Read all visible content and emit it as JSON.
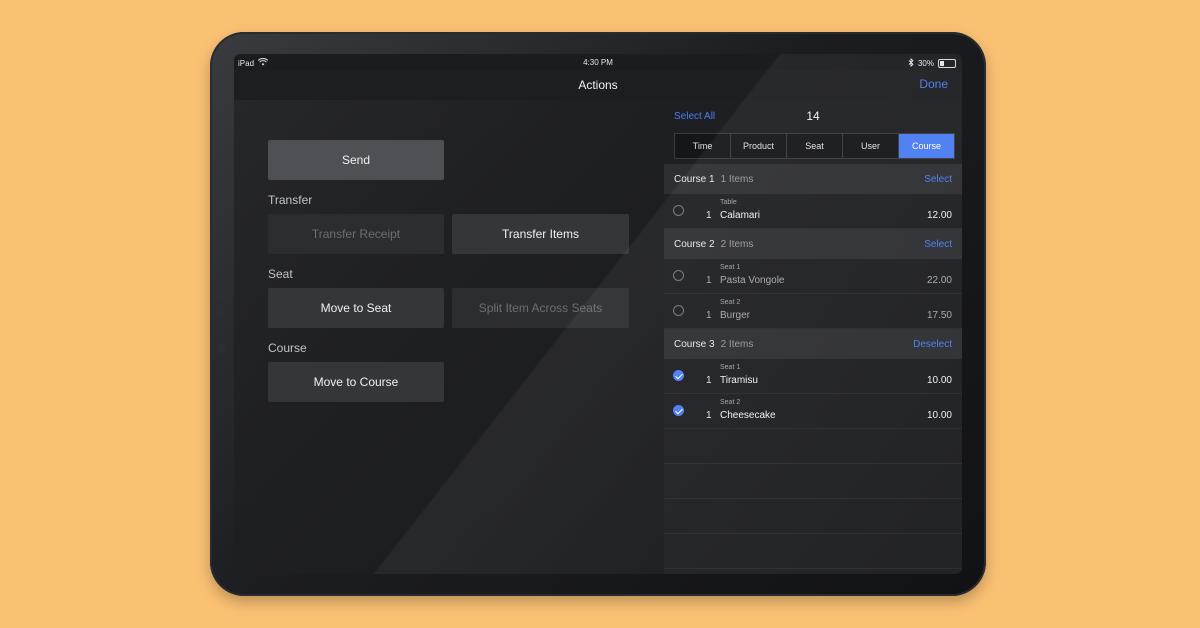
{
  "status_bar": {
    "carrier": "iPad",
    "time": "4:30 PM",
    "battery_text": "30%",
    "battery_level": 0.3,
    "icons": [
      "wifi-icon",
      "bluetooth-icon",
      "battery-icon"
    ]
  },
  "nav": {
    "title": "Actions",
    "done": "Done"
  },
  "left": {
    "send": "Send",
    "transfer_label": "Transfer",
    "transfer_receipt": "Transfer Receipt",
    "transfer_items": "Transfer Items",
    "seat_label": "Seat",
    "move_to_seat": "Move to Seat",
    "split_item": "Split Item Across Seats",
    "course_label": "Course",
    "move_to_course": "Move to Course"
  },
  "right": {
    "select_all": "Select All",
    "count": "14",
    "tabs": [
      {
        "label": "Time"
      },
      {
        "label": "Product"
      },
      {
        "label": "Seat"
      },
      {
        "label": "User"
      },
      {
        "label": "Course",
        "active": true
      }
    ],
    "courses": [
      {
        "name": "Course 1",
        "count": "1 Items",
        "action": "Select",
        "items": [
          {
            "seat": "Table",
            "qty": "1",
            "name": "Calamari",
            "price": "12.00",
            "checked": false,
            "muted": false
          }
        ]
      },
      {
        "name": "Course 2",
        "count": "2 Items",
        "action": "Select",
        "items": [
          {
            "seat": "Seat 1",
            "qty": "1",
            "name": "Pasta Vongole",
            "price": "22.00",
            "checked": false,
            "muted": true
          },
          {
            "seat": "Seat 2",
            "qty": "1",
            "name": "Burger",
            "price": "17.50",
            "checked": false,
            "muted": true
          }
        ]
      },
      {
        "name": "Course 3",
        "count": "2 Items",
        "action": "Deselect",
        "items": [
          {
            "seat": "Seat 1",
            "qty": "1",
            "name": "Tiramisu",
            "price": "10.00",
            "checked": true,
            "muted": false
          },
          {
            "seat": "Seat 2",
            "qty": "1",
            "name": "Cheesecake",
            "price": "10.00",
            "checked": true,
            "muted": false
          }
        ]
      }
    ],
    "accent_color": "#4b7df2"
  }
}
